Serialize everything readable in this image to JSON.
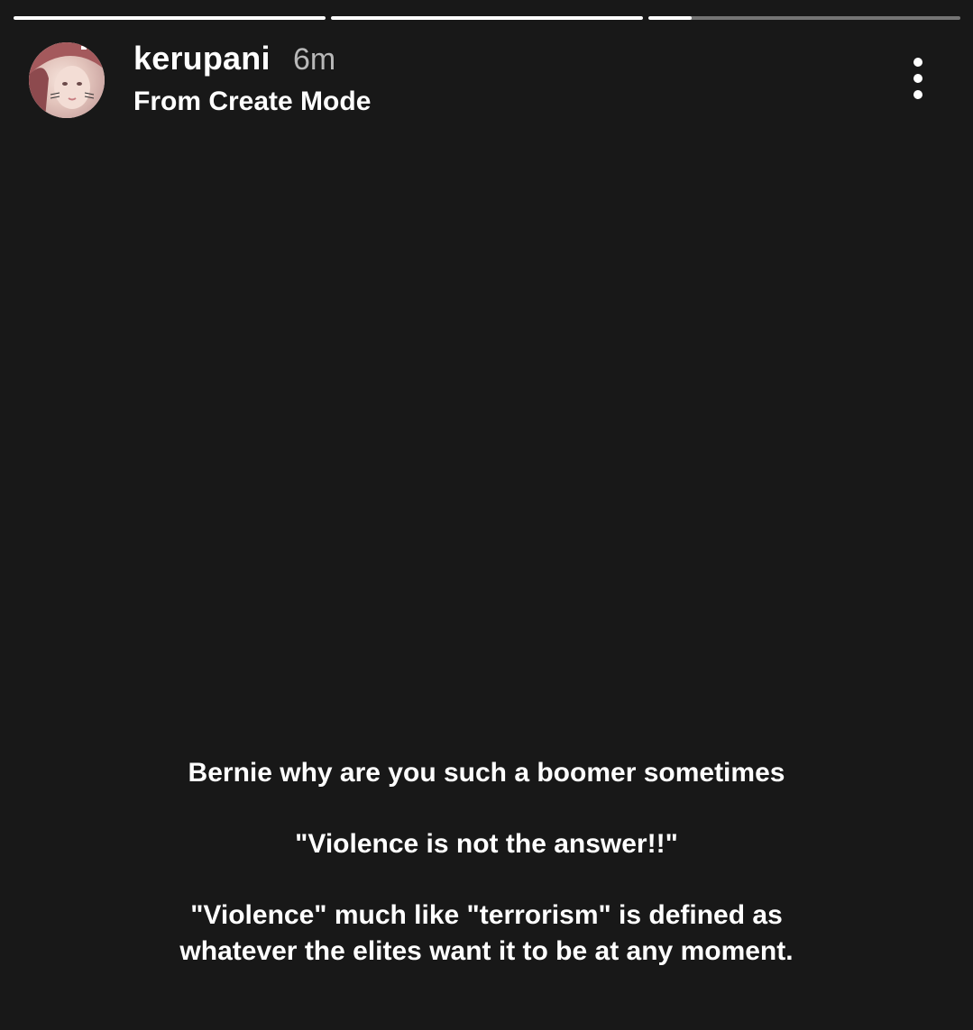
{
  "story": {
    "progress": [
      1,
      1,
      0.14
    ],
    "username": "kerupani",
    "time": "6m",
    "subtitle": "From Create Mode",
    "more_icon": "more-vertical-icon",
    "caption": {
      "line1": "Bernie why are you such a boomer sometimes",
      "line2": "\"Violence is not the answer!!\"",
      "line3": "\"Violence\" much like \"terrorism\" is defined as",
      "line4": "whatever the elites want it to be at any moment."
    }
  },
  "colors": {
    "background": "#181818",
    "text": "#ffffff",
    "muted": "#b8b8b8",
    "progress_track": "rgba(255,255,255,0.4)"
  }
}
